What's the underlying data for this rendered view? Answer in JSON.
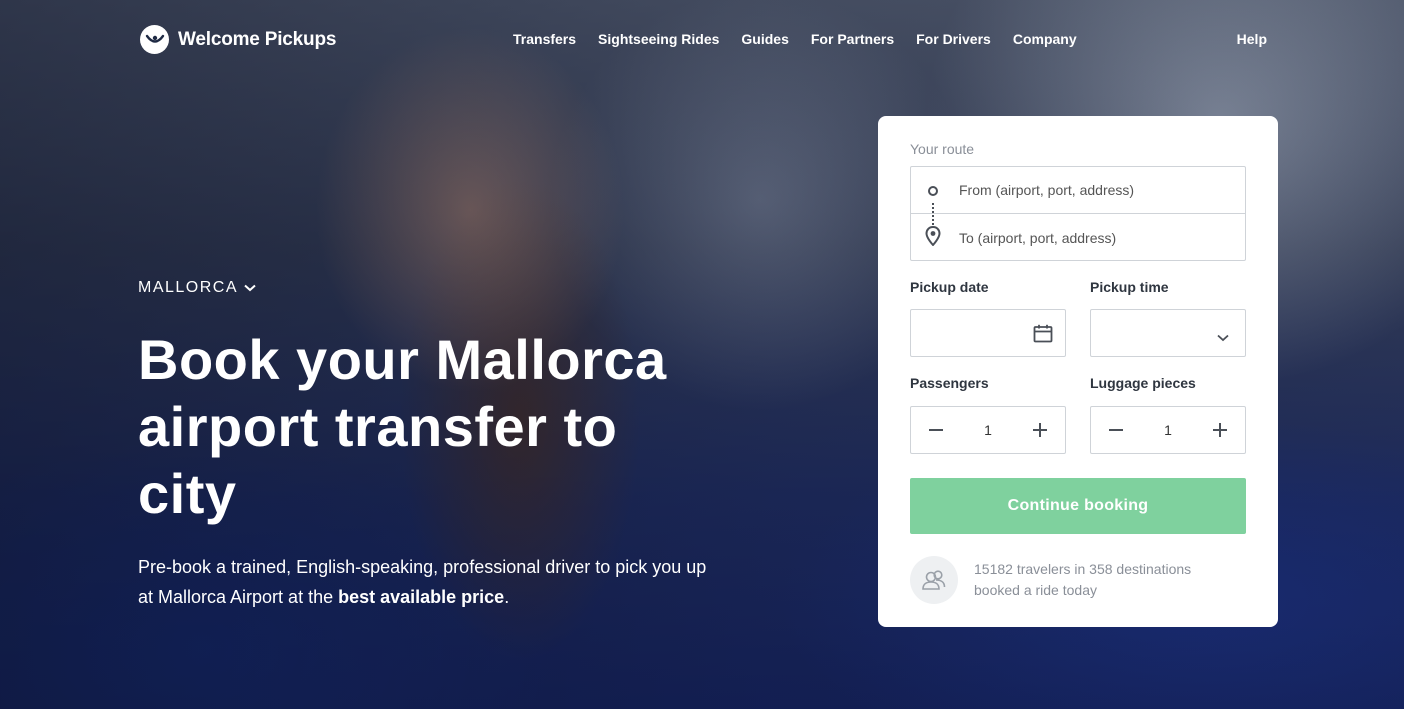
{
  "brand": {
    "name": "Welcome Pickups"
  },
  "nav": {
    "items": [
      "Transfers",
      "Sightseeing Rides",
      "Guides",
      "For Partners",
      "For Drivers",
      "Company"
    ],
    "help": "Help"
  },
  "hero": {
    "location": "MALLORCA",
    "headline": "Book your Mallorca airport transfer to city",
    "sub_prefix": "Pre-book a trained, English-speaking, professional driver to pick you up at Mallorca Airport at the ",
    "sub_bold": "best available price",
    "sub_suffix": "."
  },
  "booking": {
    "route_label": "Your route",
    "from_placeholder": "From (airport, port, address)",
    "to_placeholder": "To (airport, port, address)",
    "pickup_date_label": "Pickup date",
    "pickup_time_label": "Pickup time",
    "passengers_label": "Passengers",
    "luggage_label": "Luggage pieces",
    "passengers_value": "1",
    "luggage_value": "1",
    "continue_label": "Continue booking",
    "social_proof": "15182 travelers in 358 destinations booked a ride today"
  },
  "colors": {
    "accent": "#7fd19e",
    "text_dark": "#2f3640",
    "muted": "#8a8f98"
  },
  "icons": [
    "logo-icon",
    "chevron-down-icon",
    "origin-dot-icon",
    "location-pin-icon",
    "calendar-icon",
    "minus-icon",
    "plus-icon",
    "people-icon"
  ]
}
